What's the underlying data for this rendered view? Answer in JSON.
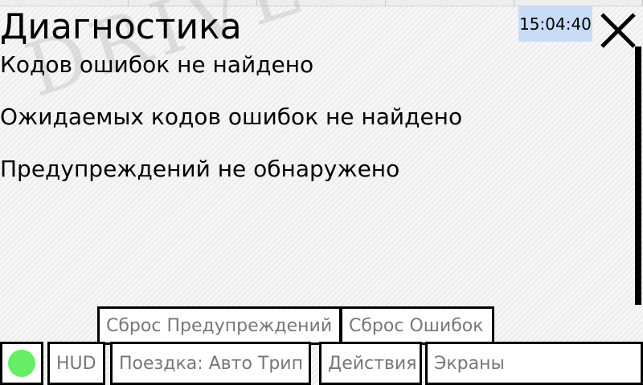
{
  "page": {
    "title": "Диагностика",
    "watermark": "DRIVE",
    "messages": [
      "Кодов ошибок не найдено",
      "Ожидаемых кодов ошибок не найдено",
      "Предупреждений не обнаружено"
    ]
  },
  "header": {
    "clock": "15:04:40"
  },
  "actions": {
    "reset_warnings": "Сброс Предупреждений",
    "reset_errors": "Сброс Ошибок"
  },
  "bottom_bar": {
    "hud": "HUD",
    "trip": "Поездка: Авто Трип",
    "actions": "Действия",
    "screens": "Экраны",
    "status_color": "#66ee66"
  },
  "icons": {
    "close": "close-icon",
    "status": "status-indicator"
  }
}
